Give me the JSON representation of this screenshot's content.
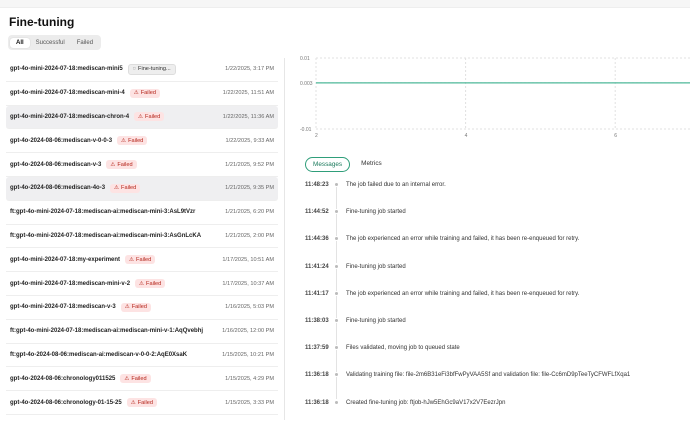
{
  "page_title": "Fine-tuning",
  "tabs": [
    "All",
    "Successful",
    "Failed"
  ],
  "jobs": [
    {
      "name": "gpt-4o-mini-2024-07-18:mediscan-mini5",
      "status": "Fine-tuning...",
      "date": "1/22/2025, 3:17 PM"
    },
    {
      "name": "gpt-4o-mini-2024-07-18:mediscan-mini-4",
      "status": "Failed",
      "date": "1/22/2025, 11:51 AM"
    },
    {
      "name": "gpt-4o-mini-2024-07-18:mediscan-chron-4",
      "status": "Failed",
      "date": "1/22/2025, 11:36 AM"
    },
    {
      "name": "gpt-4o-2024-08-06:mediscan-v-0-0-3",
      "status": "Failed",
      "date": "1/22/2025, 9:33 AM"
    },
    {
      "name": "gpt-4o-2024-08-06:mediscan-v-3",
      "status": "Failed",
      "date": "1/21/2025, 9:52 PM"
    },
    {
      "name": "gpt-4o-2024-08-06:mediscan-4o-3",
      "status": "Failed",
      "date": "1/21/2025, 9:35 PM"
    },
    {
      "name": "ft:gpt-4o-mini-2024-07-18:mediscan-ai:mediscan-mini-3:AsL9tVzr",
      "status": "",
      "date": "1/21/2025, 6:20 PM"
    },
    {
      "name": "ft:gpt-4o-mini-2024-07-18:mediscan-ai:mediscan-mini-3:AsGnLcKA",
      "status": "",
      "date": "1/21/2025, 2:00 PM"
    },
    {
      "name": "gpt-4o-mini-2024-07-18:my-experiment",
      "status": "Failed",
      "date": "1/17/2025, 10:51 AM"
    },
    {
      "name": "gpt-4o-mini-2024-07-18:mediscan-mini-v-2",
      "status": "Failed",
      "date": "1/17/2025, 10:37 AM"
    },
    {
      "name": "gpt-4o-mini-2024-07-18:mediscan-v-3",
      "status": "Failed",
      "date": "1/16/2025, 5:03 PM"
    },
    {
      "name": "ft:gpt-4o-mini-2024-07-18:mediscan-ai:mediscan-mini-v-1:AqQvebhj",
      "status": "",
      "date": "1/16/2025, 12:00 PM"
    },
    {
      "name": "ft:gpt-4o-2024-08-06:mediscan-ai:mediscan-v-0-0-2:AqE0XsaK",
      "status": "",
      "date": "1/15/2025, 10:21 PM"
    },
    {
      "name": "gpt-4o-2024-08-06:chronology011525",
      "status": "Failed",
      "date": "1/15/2025, 4:29 PM"
    },
    {
      "name": "gpt-4o-2024-08-06:chronology-01-15-25",
      "status": "Failed",
      "date": "1/15/2025, 3:33 PM"
    }
  ],
  "chart": {
    "y_ticks": [
      "0.01",
      "0.003",
      "-0.01"
    ],
    "x_ticks": [
      "2",
      "4",
      "6"
    ],
    "line_color": "#4fb89a"
  },
  "chart_data": {
    "type": "line",
    "x": [
      1,
      7
    ],
    "series": [
      {
        "values": [
          0.003,
          0.003
        ]
      }
    ],
    "ylim": [
      -0.01,
      0.01
    ],
    "xlim": [
      2,
      7
    ],
    "grid": true
  },
  "detail_tabs": [
    "Messages",
    "Metrics"
  ],
  "events": [
    {
      "time": "11:48:23",
      "msg": "The job failed due to an internal error."
    },
    {
      "time": "11:44:52",
      "msg": "Fine-tuning job started"
    },
    {
      "time": "11:44:36",
      "msg": "The job experienced an error while training and failed, it has been re-enqueued for retry."
    },
    {
      "time": "11:41:24",
      "msg": "Fine-tuning job started"
    },
    {
      "time": "11:41:17",
      "msg": "The job experienced an error while training and failed, it has been re-enqueued for retry."
    },
    {
      "time": "11:38:03",
      "msg": "Fine-tuning job started"
    },
    {
      "time": "11:37:59",
      "msg": "Files validated, moving job to queued state"
    },
    {
      "time": "11:36:18",
      "msg": "Validating training file: file-2m6B31eFi3bfFwPyVAA5Sf and validation file: file-Cc6mD9pTeeTyCFWFLfXqa1"
    },
    {
      "time": "11:36:18",
      "msg": "Created fine-tuning job: ftjob-hJw5EhGc9aV17x2V7EezrJpn"
    }
  ]
}
